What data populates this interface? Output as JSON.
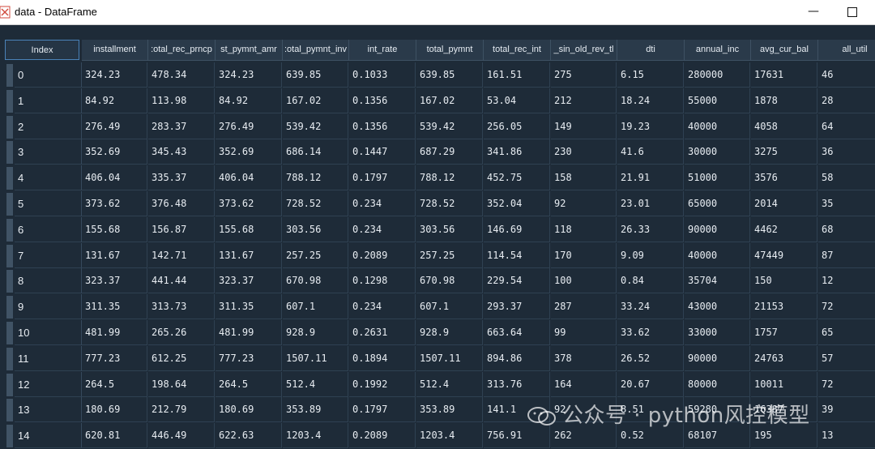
{
  "window": {
    "title": "data - DataFrame",
    "minimize_symbol": "—"
  },
  "table": {
    "columns": [
      "Index",
      "installment",
      "total_rec_prncp",
      "last_pymnt_amnt",
      "total_pymnt_inv",
      "int_rate",
      "total_pymnt",
      "total_rec_int",
      "mo_sin_old_rev_tl_op",
      "dti",
      "annual_inc",
      "avg_cur_bal",
      "all_util"
    ],
    "column_display": [
      "Index",
      "installment",
      ":otal_rec_prncp",
      "st_pymnt_amr",
      ":otal_pymnt_inv",
      "int_rate",
      "total_pymnt",
      "total_rec_int",
      "_sin_old_rev_tl",
      "dti",
      "annual_inc",
      "avg_cur_bal",
      "all_util"
    ],
    "rows": [
      [
        "0",
        "324.23",
        "478.34",
        "324.23",
        "639.85",
        "0.1033",
        "639.85",
        "161.51",
        "275",
        "6.15",
        "280000",
        "17631",
        "46"
      ],
      [
        "1",
        "84.92",
        "113.98",
        "84.92",
        "167.02",
        "0.1356",
        "167.02",
        "53.04",
        "212",
        "18.24",
        "55000",
        "1878",
        "28"
      ],
      [
        "2",
        "276.49",
        "283.37",
        "276.49",
        "539.42",
        "0.1356",
        "539.42",
        "256.05",
        "149",
        "19.23",
        "40000",
        "4058",
        "64"
      ],
      [
        "3",
        "352.69",
        "345.43",
        "352.69",
        "686.14",
        "0.1447",
        "687.29",
        "341.86",
        "230",
        "41.6",
        "30000",
        "3275",
        "36"
      ],
      [
        "4",
        "406.04",
        "335.37",
        "406.04",
        "788.12",
        "0.1797",
        "788.12",
        "452.75",
        "158",
        "21.91",
        "51000",
        "3576",
        "58"
      ],
      [
        "5",
        "373.62",
        "376.48",
        "373.62",
        "728.52",
        "0.234",
        "728.52",
        "352.04",
        "92",
        "23.01",
        "65000",
        "2014",
        "35"
      ],
      [
        "6",
        "155.68",
        "156.87",
        "155.68",
        "303.56",
        "0.234",
        "303.56",
        "146.69",
        "118",
        "26.33",
        "90000",
        "4462",
        "68"
      ],
      [
        "7",
        "131.67",
        "142.71",
        "131.67",
        "257.25",
        "0.2089",
        "257.25",
        "114.54",
        "170",
        "9.09",
        "40000",
        "47449",
        "87"
      ],
      [
        "8",
        "323.37",
        "441.44",
        "323.37",
        "670.98",
        "0.1298",
        "670.98",
        "229.54",
        "100",
        "0.84",
        "35704",
        "150",
        "12"
      ],
      [
        "9",
        "311.35",
        "313.73",
        "311.35",
        "607.1",
        "0.234",
        "607.1",
        "293.37",
        "287",
        "33.24",
        "43000",
        "21153",
        "72"
      ],
      [
        "10",
        "481.99",
        "265.26",
        "481.99",
        "928.9",
        "0.2631",
        "928.9",
        "663.64",
        "99",
        "33.62",
        "33000",
        "1757",
        "65"
      ],
      [
        "11",
        "777.23",
        "612.25",
        "777.23",
        "1507.11",
        "0.1894",
        "1507.11",
        "894.86",
        "378",
        "26.52",
        "90000",
        "24763",
        "57"
      ],
      [
        "12",
        "264.5",
        "198.64",
        "264.5",
        "512.4",
        "0.1992",
        "512.4",
        "313.76",
        "164",
        "20.67",
        "80000",
        "10011",
        "72"
      ],
      [
        "13",
        "180.69",
        "212.79",
        "180.69",
        "353.89",
        "0.1797",
        "353.89",
        "141.1",
        "92",
        "8.51",
        "59280",
        "16387",
        "39"
      ],
      [
        "14",
        "620.81",
        "446.49",
        "622.63",
        "1203.4",
        "0.2089",
        "1203.4",
        "756.91",
        "262",
        "0.52",
        "68107",
        "195",
        "13"
      ]
    ]
  },
  "watermark": {
    "text": "公众号 · python风控模型"
  },
  "colors": {
    "background": "#1e2b38",
    "header": "#2a3a4a",
    "accent": "#4a82b8",
    "text": "#e8edf2"
  }
}
